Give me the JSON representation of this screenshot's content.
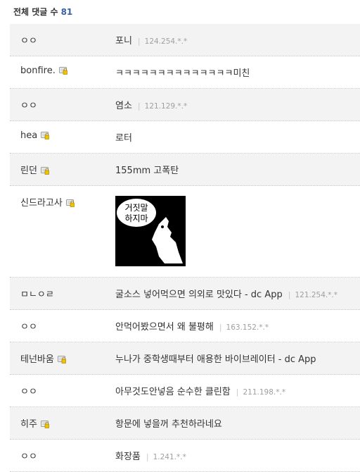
{
  "header": {
    "label": "전체 댓글 수",
    "count": "81"
  },
  "comments": [
    {
      "nick": "ㅇㅇ",
      "text": "포니",
      "ip": "124.254.*.*",
      "grey": true,
      "lock": false
    },
    {
      "nick": "bonfire.",
      "text": "ㅋㅋㅋㅋㅋㅋㅋㅋㅋㅋㅋㅋㅋㅋ미친",
      "ip": "",
      "grey": false,
      "lock": true
    },
    {
      "nick": "ㅇㅇ",
      "text": "염소",
      "ip": "121.129.*.*",
      "grey": true,
      "lock": false
    },
    {
      "nick": "hea",
      "text": "로터",
      "ip": "",
      "grey": false,
      "lock": true
    },
    {
      "nick": "린던",
      "text": "155mm 고폭탄",
      "ip": "",
      "grey": true,
      "lock": true
    },
    {
      "nick": "신드라고사",
      "text": "",
      "ip": "",
      "grey": false,
      "lock": true,
      "image": true,
      "image_text": [
        "거짓말",
        "하지마"
      ]
    },
    {
      "nick": "ㅁㄴㅇㄹ",
      "text": "굴소스 넣어먹으면 의외로 맛있다 - dc App",
      "ip": "121.254.*.*",
      "grey": true,
      "lock": false
    },
    {
      "nick": "ㅇㅇ",
      "text": "안먹어봤으면서 왜 불평해",
      "ip": "163.152.*.*",
      "grey": false,
      "lock": false
    },
    {
      "nick": "테넌바움",
      "text": "누나가 중학생때부터 애용한 바이브레이터 - dc App",
      "ip": "",
      "grey": true,
      "lock": true
    },
    {
      "nick": "ㅇㅇ",
      "text": "아무것도안넣음 순수한 클린함",
      "ip": "211.198.*.*",
      "grey": false,
      "lock": false
    },
    {
      "nick": "히주",
      "text": "항문에 넣을꺼 추천하라네요",
      "ip": "",
      "grey": true,
      "lock": true
    },
    {
      "nick": "ㅇㅇ",
      "text": "화장품",
      "ip": "1.241.*.*",
      "grey": false,
      "lock": false
    }
  ]
}
